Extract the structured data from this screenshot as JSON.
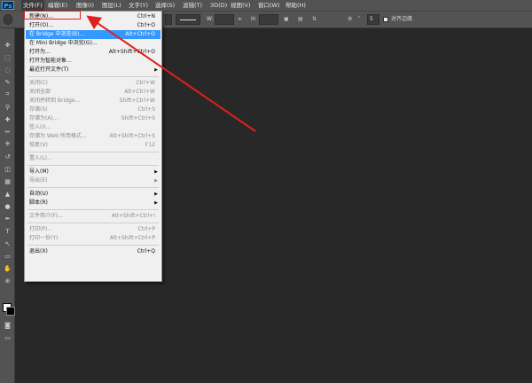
{
  "app": {
    "logo": "Ps"
  },
  "menubar": [
    {
      "label": "文件(F)",
      "active": true
    },
    {
      "label": "编辑(E)"
    },
    {
      "label": "图像(I)"
    },
    {
      "label": "图层(L)"
    },
    {
      "label": "文字(Y)"
    },
    {
      "label": "选择(S)"
    },
    {
      "label": "滤镜(T)"
    },
    {
      "label": "3D(D)"
    },
    {
      "label": "视图(V)"
    },
    {
      "label": "窗口(W)"
    },
    {
      "label": "帮助(H)"
    }
  ],
  "options": {
    "w_label": "W:",
    "h_label": "H:",
    "stroke_value": "5",
    "align_edges": "对齐边缘"
  },
  "file_menu": {
    "items": [
      {
        "label": "新建(N)...",
        "shortcut": "Ctrl+N",
        "disabled": false
      },
      {
        "label": "打开(O)...",
        "shortcut": "Ctrl+O",
        "disabled": false
      },
      {
        "label": "在 Bridge 中浏览(B)...",
        "shortcut": "Alt+Ctrl+O",
        "disabled": false,
        "highlight": true
      },
      {
        "label": "在 Mini Bridge 中浏览(G)...",
        "shortcut": "",
        "disabled": false
      },
      {
        "label": "打开为...",
        "shortcut": "Alt+Shift+Ctrl+O",
        "disabled": false
      },
      {
        "label": "打开为智能对象...",
        "shortcut": "",
        "disabled": false
      },
      {
        "label": "最近打开文件(T)",
        "shortcut": "",
        "disabled": false,
        "submenu": true
      },
      {
        "sep": true
      },
      {
        "label": "关闭(C)",
        "shortcut": "Ctrl+W",
        "disabled": true
      },
      {
        "label": "关闭全部",
        "shortcut": "Alt+Ctrl+W",
        "disabled": true
      },
      {
        "label": "关闭并转到 Bridge...",
        "shortcut": "Shift+Ctrl+W",
        "disabled": true
      },
      {
        "label": "存储(S)",
        "shortcut": "Ctrl+S",
        "disabled": true
      },
      {
        "label": "存储为(A)...",
        "shortcut": "Shift+Ctrl+S",
        "disabled": true
      },
      {
        "label": "签入(I)...",
        "shortcut": "",
        "disabled": true
      },
      {
        "label": "存储为 Web 所用格式...",
        "shortcut": "Alt+Shift+Ctrl+S",
        "disabled": true
      },
      {
        "label": "恢复(V)",
        "shortcut": "F12",
        "disabled": true
      },
      {
        "sep": true
      },
      {
        "label": "置入(L)...",
        "shortcut": "",
        "disabled": true
      },
      {
        "sep": true
      },
      {
        "label": "导入(M)",
        "shortcut": "",
        "disabled": false,
        "submenu": true
      },
      {
        "label": "导出(E)",
        "shortcut": "",
        "disabled": true,
        "submenu": true
      },
      {
        "sep": true
      },
      {
        "label": "自动(U)",
        "shortcut": "",
        "disabled": false,
        "submenu": true
      },
      {
        "label": "脚本(R)",
        "shortcut": "",
        "disabled": false,
        "submenu": true
      },
      {
        "sep": true
      },
      {
        "label": "文件简介(F)...",
        "shortcut": "Alt+Shift+Ctrl+I",
        "disabled": true
      },
      {
        "sep": true
      },
      {
        "label": "打印(P)...",
        "shortcut": "Ctrl+P",
        "disabled": true
      },
      {
        "label": "打印一份(Y)",
        "shortcut": "Alt+Shift+Ctrl+P",
        "disabled": true
      },
      {
        "sep": true
      },
      {
        "label": "退出(X)",
        "shortcut": "Ctrl+Q",
        "disabled": false
      }
    ]
  },
  "tools": [
    "move-icon",
    "marquee-icon",
    "lasso-icon",
    "quick-select-icon",
    "crop-icon",
    "eyedropper-icon",
    "healing-icon",
    "brush-icon",
    "stamp-icon",
    "history-brush-icon",
    "eraser-icon",
    "gradient-icon",
    "blur-icon",
    "dodge-icon",
    "pen-icon",
    "type-icon",
    "path-select-icon",
    "shape-icon",
    "hand-icon",
    "zoom-icon"
  ],
  "colors": {
    "accent": "#3399ff",
    "annotation": "#e02020"
  }
}
